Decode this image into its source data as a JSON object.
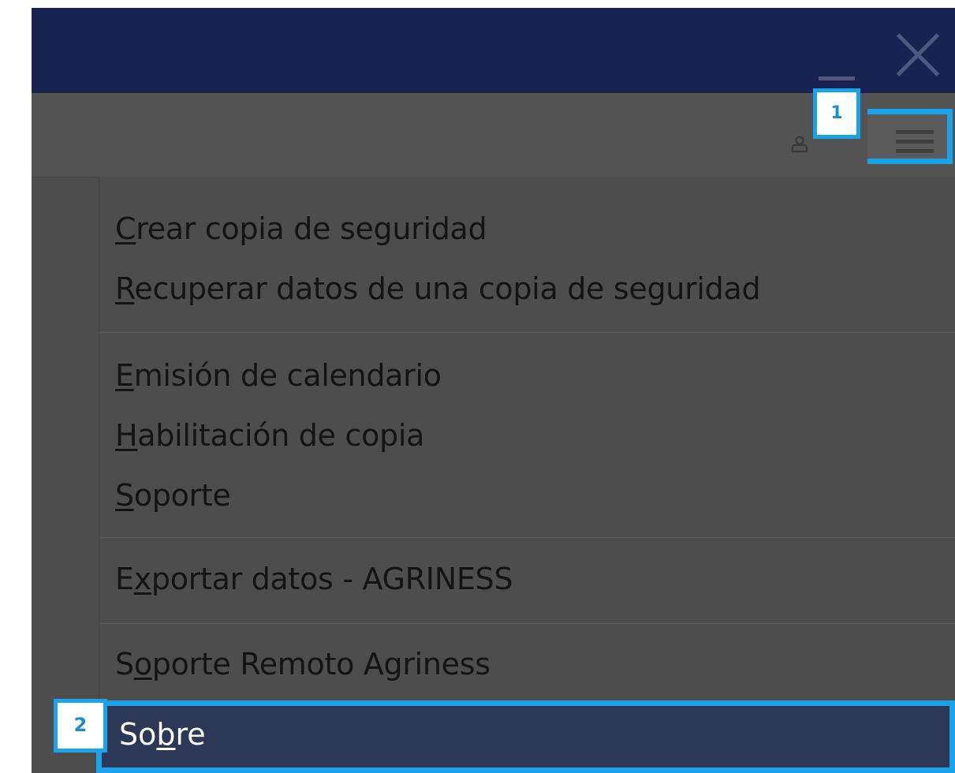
{
  "window": {
    "minimize_icon": "minimize-icon",
    "close_icon": "close-icon",
    "titlebar_color": "#1a2251"
  },
  "toolbar": {
    "user_icon": "user-icon",
    "menu_icon": "hamburger-icon"
  },
  "callouts": {
    "step1": "1",
    "step2": "2",
    "color": "#1aa3e8"
  },
  "menu": {
    "items": [
      {
        "prefix": "",
        "accel": "C",
        "suffix": "rear copia de seguridad"
      },
      {
        "prefix": "",
        "accel": "R",
        "suffix": "ecuperar datos de una copia de seguridad"
      },
      {
        "prefix": "",
        "accel": "E",
        "suffix": "misión de calendario"
      },
      {
        "prefix": "",
        "accel": "H",
        "suffix": "abilitación de copia"
      },
      {
        "prefix": "",
        "accel": "S",
        "suffix": "oporte"
      },
      {
        "prefix": "E",
        "accel": "x",
        "suffix": "portar datos - AGRINESS"
      },
      {
        "prefix": "S",
        "accel": "o",
        "suffix": "porte Remoto Agriness"
      }
    ],
    "selected": {
      "prefix": "So",
      "accel": "b",
      "suffix": "re"
    }
  }
}
